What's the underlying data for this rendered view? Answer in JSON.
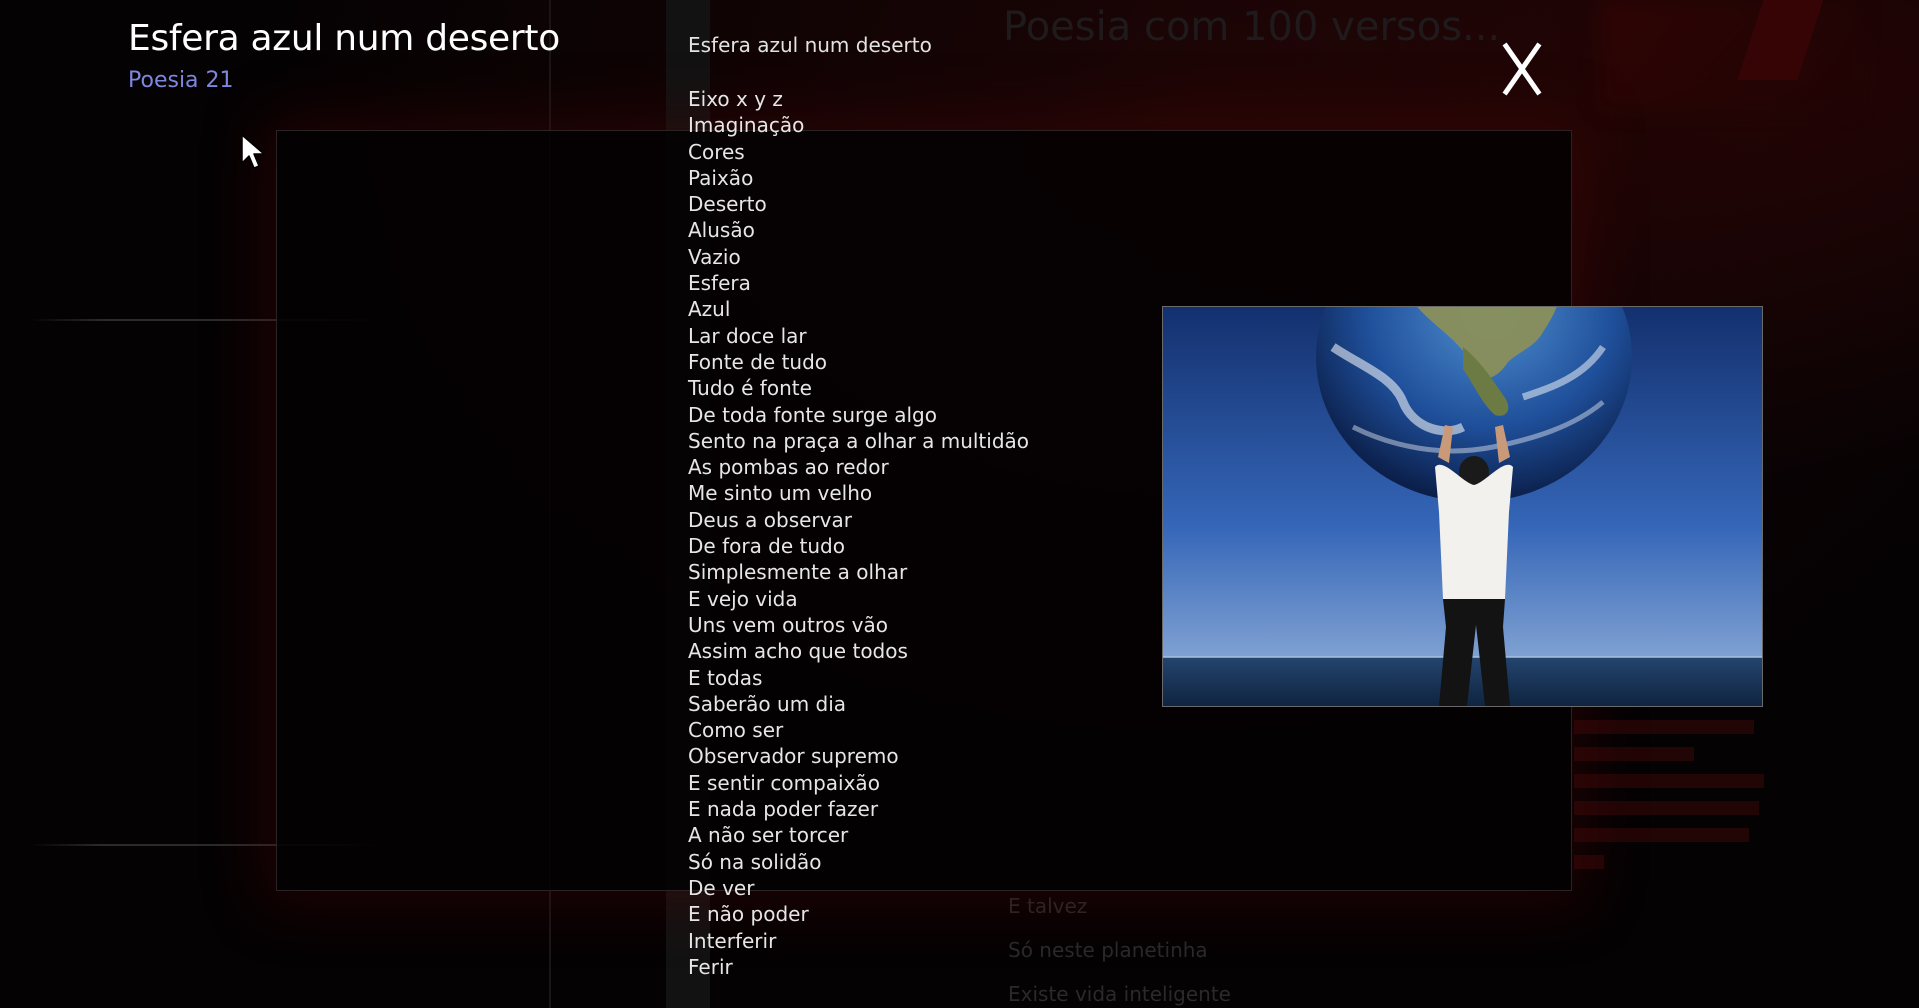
{
  "header": {
    "title": "Esfera azul num deserto",
    "subtitle": "Poesia 21"
  },
  "close": {
    "label": "X"
  },
  "poem": {
    "title": "Esfera azul num deserto",
    "lines": [
      "Eixo x y z",
      "Imaginação",
      "Cores",
      "Paixão",
      "Deserto",
      "Alusão",
      "Vazio",
      "Esfera",
      "Azul",
      "Lar doce lar",
      "Fonte de tudo",
      "Tudo é fonte",
      "De toda fonte surge algo",
      "Sento na praça a olhar a multidão",
      "As pombas ao redor",
      "Me sinto um velho",
      "Deus a observar",
      "De fora de tudo",
      "Simplesmente a olhar",
      "E vejo vida",
      "Uns vem outros vão",
      "Assim acho que todos",
      "E todas",
      "Saberão um dia",
      "Como ser",
      "Observador supremo",
      "E sentir compaixão",
      "E nada poder fazer",
      "A não ser torcer",
      "Só na solidão",
      "De ver",
      "E não poder",
      "Interferir",
      "Ferir"
    ]
  },
  "background_page": {
    "title": "Poesia com 100 versos...",
    "lines": [
      "E talvez",
      "Só neste planetinha",
      "Existe vida inteligente"
    ]
  },
  "colors": {
    "title": "#ffffff",
    "subtitle": "#7f86de",
    "poem_text": "#e6e6e6",
    "background": "#050203",
    "accent_red": "#3a0506"
  },
  "icons": {
    "close": "close-icon",
    "cursor": "mouse-pointer-icon"
  }
}
